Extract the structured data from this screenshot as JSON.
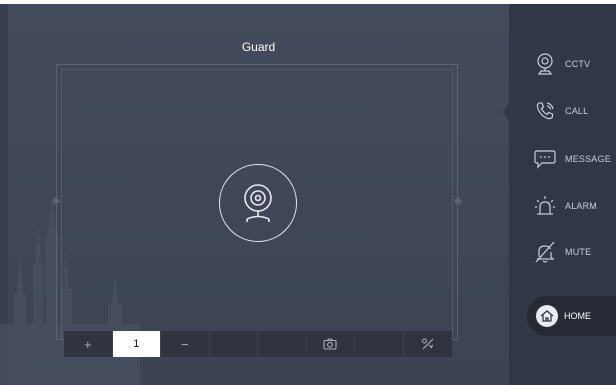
{
  "header": {
    "title": "Guard"
  },
  "toolbar": {
    "zoom_in_symbol": "+",
    "channel_value": "1",
    "zoom_out_symbol": "−"
  },
  "sidebar": {
    "items": [
      {
        "label": "CCTV",
        "icon": "cctv-icon"
      },
      {
        "label": "CALL",
        "icon": "phone-icon"
      },
      {
        "label": "MESSAGE",
        "icon": "message-icon"
      },
      {
        "label": "ALARM",
        "icon": "alarm-icon"
      },
      {
        "label": "MUTE",
        "icon": "mute-icon"
      }
    ],
    "home_label": "HOME"
  },
  "colors": {
    "background": "#3f4455",
    "sidebar": "#323746",
    "toolbar": "#30343f",
    "active_cell": "#ffffff"
  }
}
